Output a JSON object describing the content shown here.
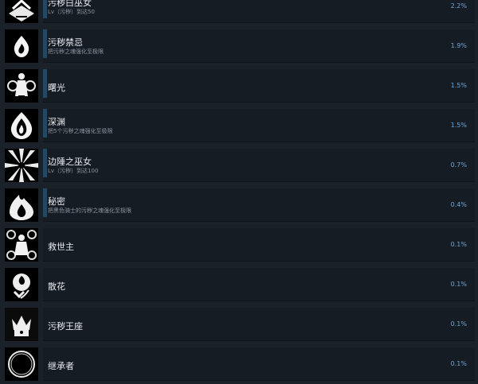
{
  "achievements": [
    {
      "title": "污秽白巫女",
      "desc": "Lv（污秽）到达50",
      "percent": "2.2%",
      "progress": 0.04,
      "icon": "white-witch-icon"
    },
    {
      "title": "污秽禁忌",
      "desc": "把污秽之魂强化至极限",
      "percent": "1.9%",
      "progress": 0.04,
      "icon": "flame-icon"
    },
    {
      "title": "曙光",
      "desc": "",
      "percent": "1.5%",
      "progress": 0.03,
      "icon": "dawn-maiden-icon"
    },
    {
      "title": "深渊",
      "desc": "把5个污秽之魂强化至极限",
      "percent": "1.5%",
      "progress": 0.03,
      "icon": "abyss-flame-icon"
    },
    {
      "title": "边陲之巫女",
      "desc": "Lv（污秽）到达100",
      "percent": "0.7%",
      "progress": 0.01,
      "icon": "burst-icon"
    },
    {
      "title": "秘密",
      "desc": "把黑色骑士的污秽之魂强化至极限",
      "percent": "0.4%",
      "progress": 0.01,
      "icon": "secret-flame-icon"
    },
    {
      "title": "救世主",
      "desc": "",
      "percent": "0.1%",
      "progress": 0.0,
      "icon": "savior-icon"
    },
    {
      "title": "散花",
      "desc": "",
      "percent": "0.1%",
      "progress": 0.0,
      "icon": "rose-icon"
    },
    {
      "title": "污秽王座",
      "desc": "",
      "percent": "0.1%",
      "progress": 0.0,
      "icon": "throne-icon"
    },
    {
      "title": "继承者",
      "desc": "",
      "percent": "0.1%",
      "progress": 0.0,
      "icon": "ring-icon"
    }
  ]
}
